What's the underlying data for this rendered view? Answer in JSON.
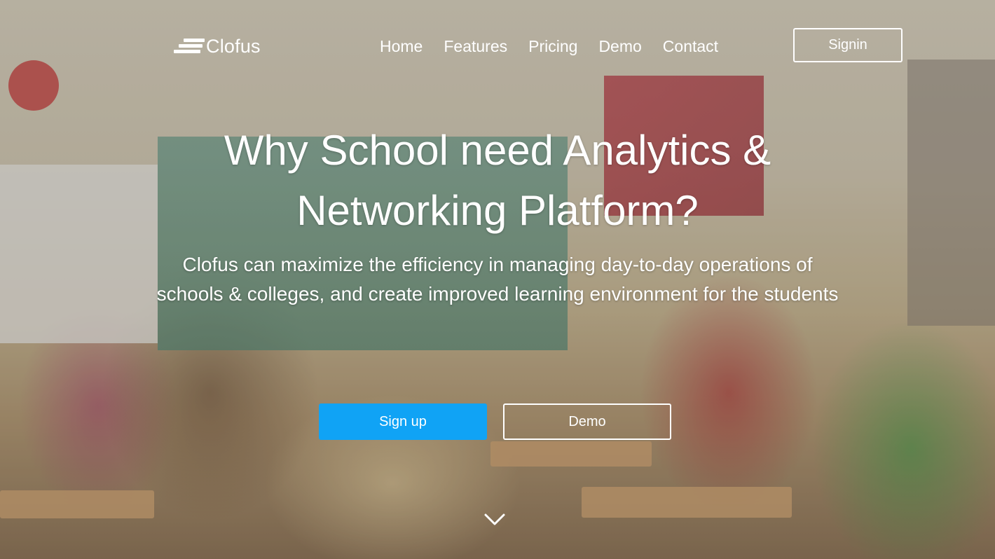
{
  "nav": {
    "logo_text": "Clofus",
    "menu": [
      {
        "label": "Home"
      },
      {
        "label": "Features"
      },
      {
        "label": "Pricing"
      },
      {
        "label": "Demo"
      },
      {
        "label": "Contact"
      }
    ],
    "signin_label": "Signin"
  },
  "hero": {
    "title_line1": "Why School need Analytics &",
    "title_line2": "Networking Platform?",
    "subtitle": "Clofus can maximize the efficiency in managing day-to-day operations of schools & colleges, and create improved learning environment for the students",
    "signup_label": "Sign up",
    "demo_label": "Demo",
    "scroll_icon": "chevron-down-icon"
  },
  "colors": {
    "primary": "#10a3f5",
    "text": "#ffffff"
  }
}
